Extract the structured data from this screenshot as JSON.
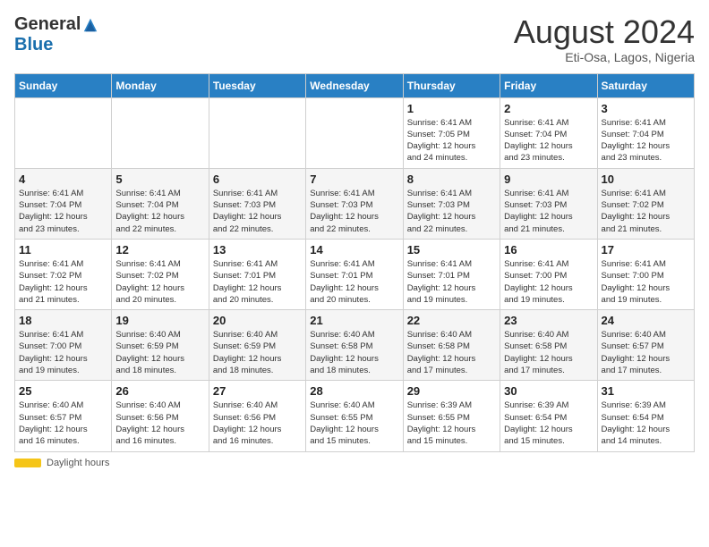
{
  "header": {
    "logo_general": "General",
    "logo_blue": "Blue",
    "month_title": "August 2024",
    "subtitle": "Eti-Osa, Lagos, Nigeria"
  },
  "days_of_week": [
    "Sunday",
    "Monday",
    "Tuesday",
    "Wednesday",
    "Thursday",
    "Friday",
    "Saturday"
  ],
  "weeks": [
    [
      {
        "day": "",
        "info": ""
      },
      {
        "day": "",
        "info": ""
      },
      {
        "day": "",
        "info": ""
      },
      {
        "day": "",
        "info": ""
      },
      {
        "day": "1",
        "info": "Sunrise: 6:41 AM\nSunset: 7:05 PM\nDaylight: 12 hours\nand 24 minutes."
      },
      {
        "day": "2",
        "info": "Sunrise: 6:41 AM\nSunset: 7:04 PM\nDaylight: 12 hours\nand 23 minutes."
      },
      {
        "day": "3",
        "info": "Sunrise: 6:41 AM\nSunset: 7:04 PM\nDaylight: 12 hours\nand 23 minutes."
      }
    ],
    [
      {
        "day": "4",
        "info": "Sunrise: 6:41 AM\nSunset: 7:04 PM\nDaylight: 12 hours\nand 23 minutes."
      },
      {
        "day": "5",
        "info": "Sunrise: 6:41 AM\nSunset: 7:04 PM\nDaylight: 12 hours\nand 22 minutes."
      },
      {
        "day": "6",
        "info": "Sunrise: 6:41 AM\nSunset: 7:03 PM\nDaylight: 12 hours\nand 22 minutes."
      },
      {
        "day": "7",
        "info": "Sunrise: 6:41 AM\nSunset: 7:03 PM\nDaylight: 12 hours\nand 22 minutes."
      },
      {
        "day": "8",
        "info": "Sunrise: 6:41 AM\nSunset: 7:03 PM\nDaylight: 12 hours\nand 22 minutes."
      },
      {
        "day": "9",
        "info": "Sunrise: 6:41 AM\nSunset: 7:03 PM\nDaylight: 12 hours\nand 21 minutes."
      },
      {
        "day": "10",
        "info": "Sunrise: 6:41 AM\nSunset: 7:02 PM\nDaylight: 12 hours\nand 21 minutes."
      }
    ],
    [
      {
        "day": "11",
        "info": "Sunrise: 6:41 AM\nSunset: 7:02 PM\nDaylight: 12 hours\nand 21 minutes."
      },
      {
        "day": "12",
        "info": "Sunrise: 6:41 AM\nSunset: 7:02 PM\nDaylight: 12 hours\nand 20 minutes."
      },
      {
        "day": "13",
        "info": "Sunrise: 6:41 AM\nSunset: 7:01 PM\nDaylight: 12 hours\nand 20 minutes."
      },
      {
        "day": "14",
        "info": "Sunrise: 6:41 AM\nSunset: 7:01 PM\nDaylight: 12 hours\nand 20 minutes."
      },
      {
        "day": "15",
        "info": "Sunrise: 6:41 AM\nSunset: 7:01 PM\nDaylight: 12 hours\nand 19 minutes."
      },
      {
        "day": "16",
        "info": "Sunrise: 6:41 AM\nSunset: 7:00 PM\nDaylight: 12 hours\nand 19 minutes."
      },
      {
        "day": "17",
        "info": "Sunrise: 6:41 AM\nSunset: 7:00 PM\nDaylight: 12 hours\nand 19 minutes."
      }
    ],
    [
      {
        "day": "18",
        "info": "Sunrise: 6:41 AM\nSunset: 7:00 PM\nDaylight: 12 hours\nand 19 minutes."
      },
      {
        "day": "19",
        "info": "Sunrise: 6:40 AM\nSunset: 6:59 PM\nDaylight: 12 hours\nand 18 minutes."
      },
      {
        "day": "20",
        "info": "Sunrise: 6:40 AM\nSunset: 6:59 PM\nDaylight: 12 hours\nand 18 minutes."
      },
      {
        "day": "21",
        "info": "Sunrise: 6:40 AM\nSunset: 6:58 PM\nDaylight: 12 hours\nand 18 minutes."
      },
      {
        "day": "22",
        "info": "Sunrise: 6:40 AM\nSunset: 6:58 PM\nDaylight: 12 hours\nand 17 minutes."
      },
      {
        "day": "23",
        "info": "Sunrise: 6:40 AM\nSunset: 6:58 PM\nDaylight: 12 hours\nand 17 minutes."
      },
      {
        "day": "24",
        "info": "Sunrise: 6:40 AM\nSunset: 6:57 PM\nDaylight: 12 hours\nand 17 minutes."
      }
    ],
    [
      {
        "day": "25",
        "info": "Sunrise: 6:40 AM\nSunset: 6:57 PM\nDaylight: 12 hours\nand 16 minutes."
      },
      {
        "day": "26",
        "info": "Sunrise: 6:40 AM\nSunset: 6:56 PM\nDaylight: 12 hours\nand 16 minutes."
      },
      {
        "day": "27",
        "info": "Sunrise: 6:40 AM\nSunset: 6:56 PM\nDaylight: 12 hours\nand 16 minutes."
      },
      {
        "day": "28",
        "info": "Sunrise: 6:40 AM\nSunset: 6:55 PM\nDaylight: 12 hours\nand 15 minutes."
      },
      {
        "day": "29",
        "info": "Sunrise: 6:39 AM\nSunset: 6:55 PM\nDaylight: 12 hours\nand 15 minutes."
      },
      {
        "day": "30",
        "info": "Sunrise: 6:39 AM\nSunset: 6:54 PM\nDaylight: 12 hours\nand 15 minutes."
      },
      {
        "day": "31",
        "info": "Sunrise: 6:39 AM\nSunset: 6:54 PM\nDaylight: 12 hours\nand 14 minutes."
      }
    ]
  ],
  "footer": {
    "daylight_label": "Daylight hours"
  }
}
